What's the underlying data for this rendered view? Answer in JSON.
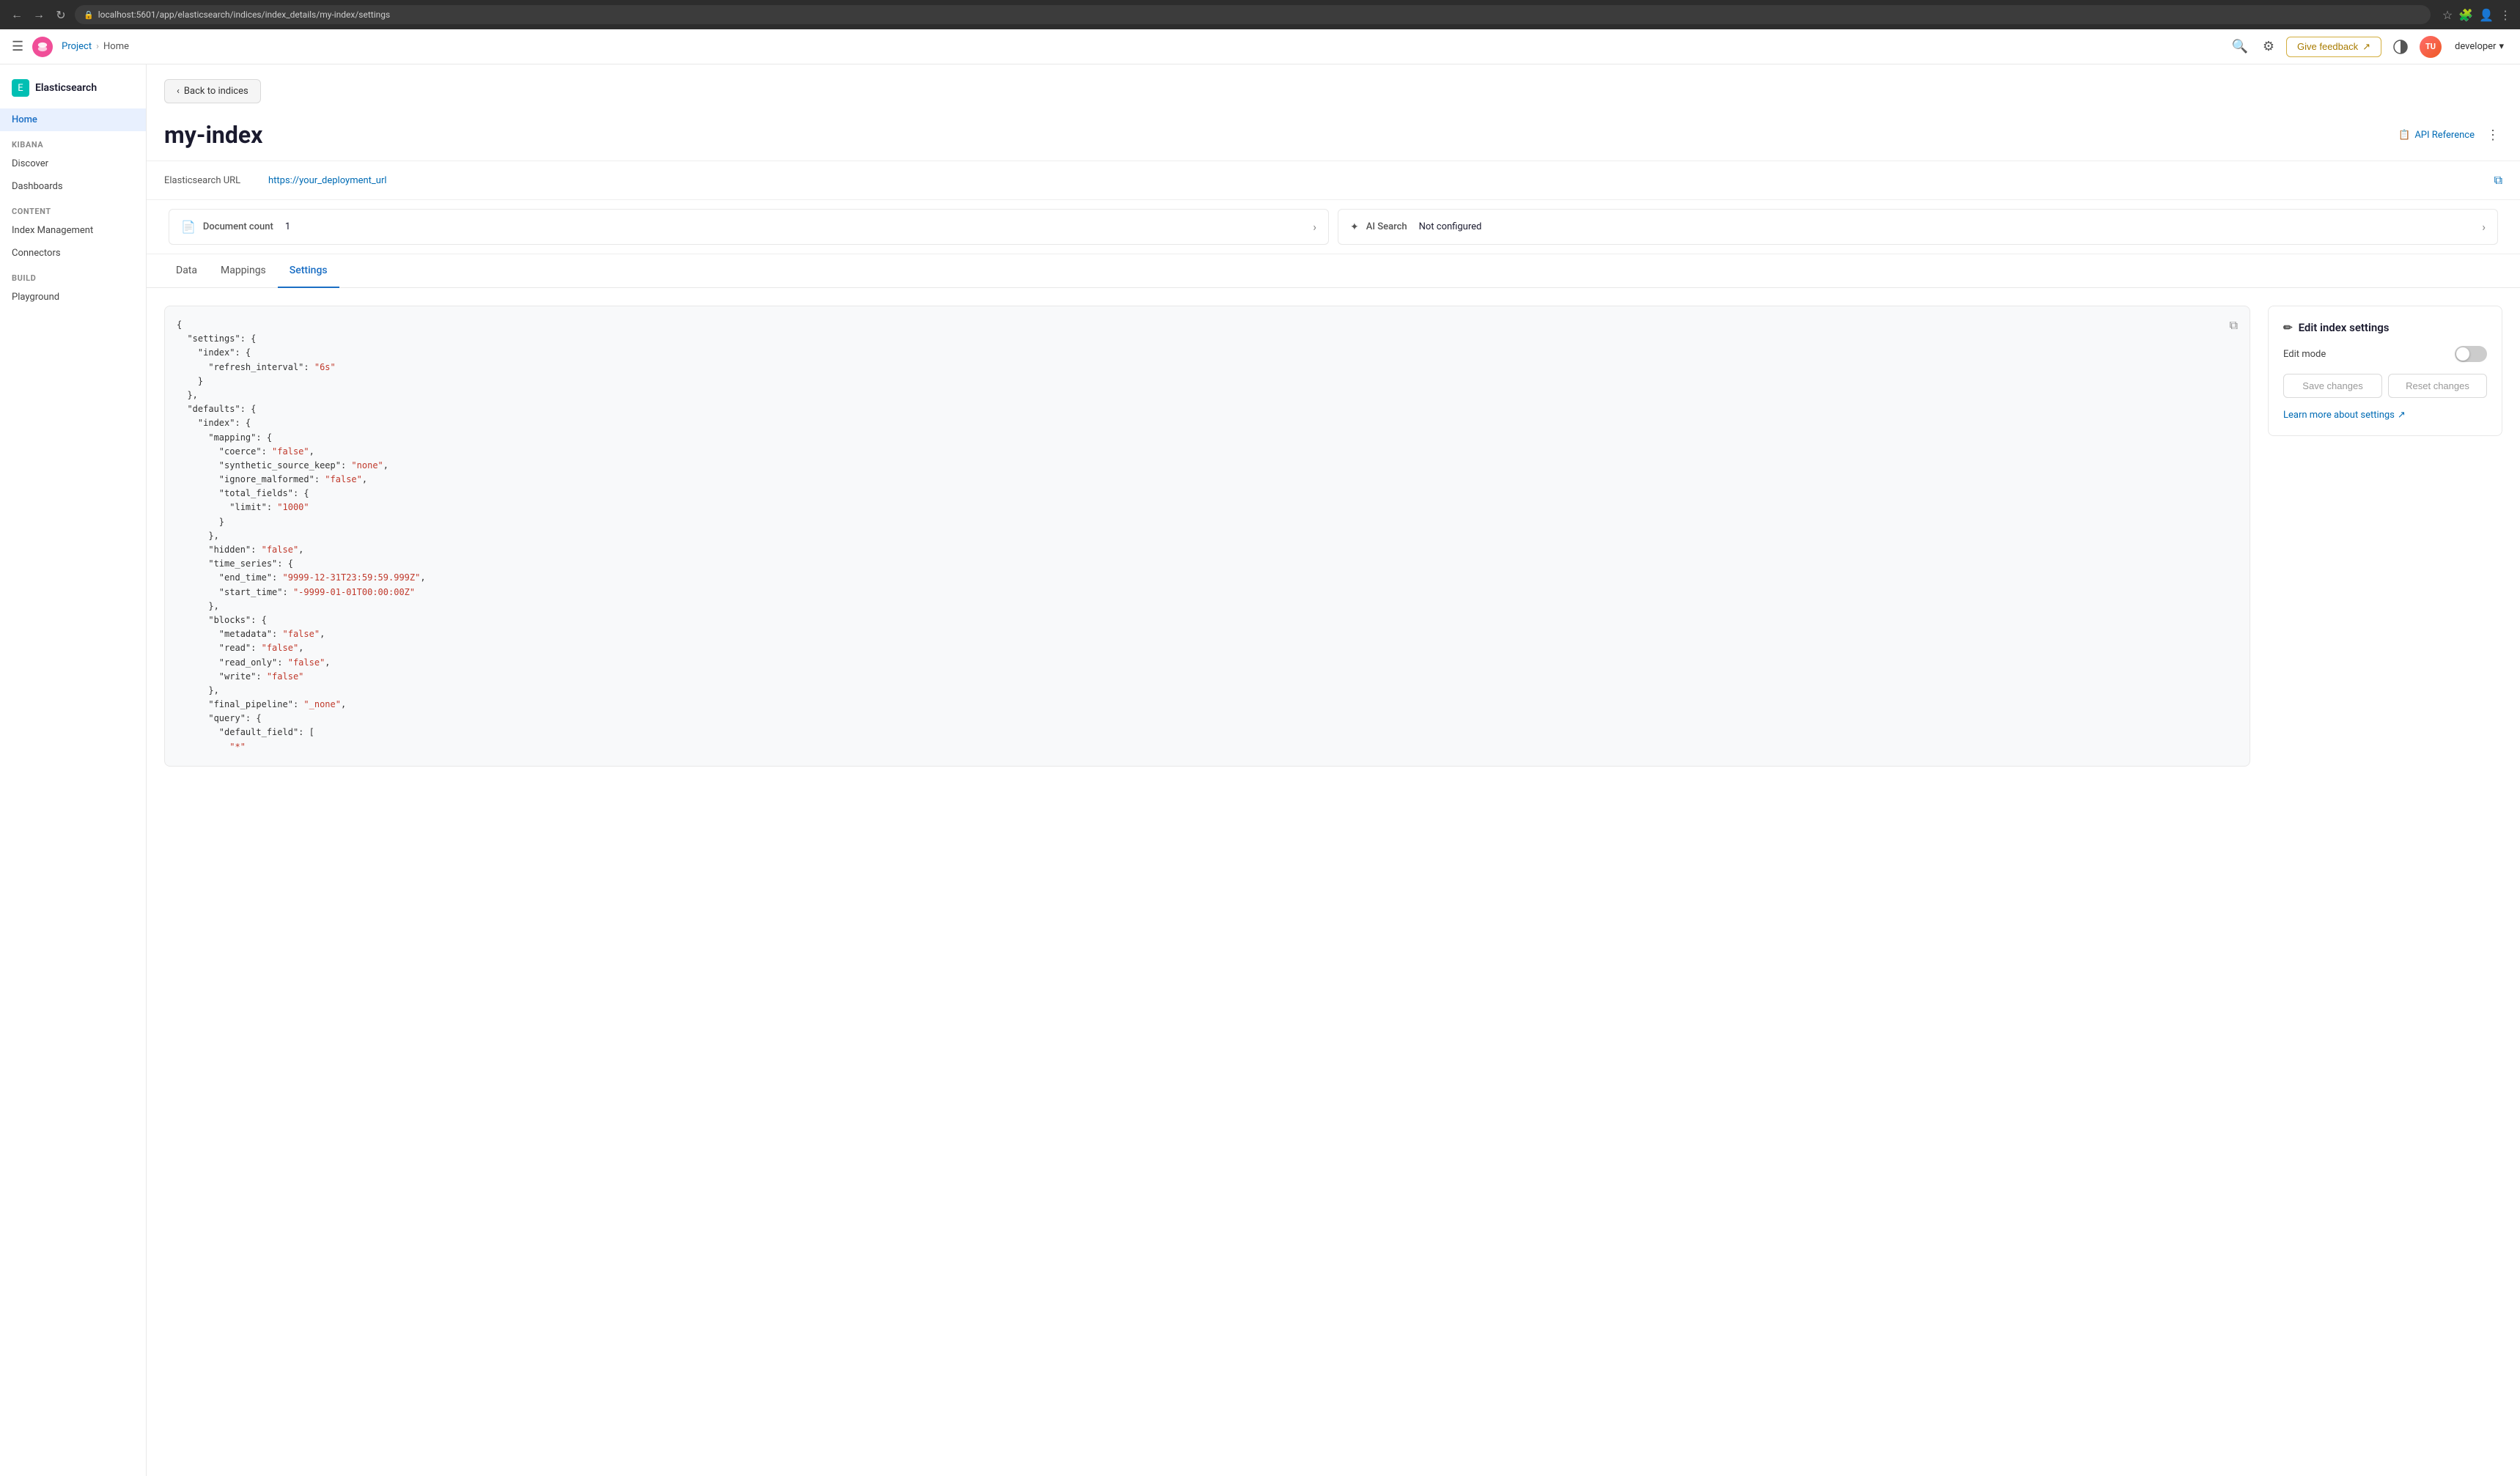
{
  "browser": {
    "url": "localhost:5601/app/elasticsearch/indices/index_details/my-index/settings",
    "back_tooltip": "Back",
    "forward_tooltip": "Forward",
    "refresh_tooltip": "Refresh"
  },
  "header": {
    "logo_alt": "Elastic",
    "project_label": "Project",
    "home_label": "Home",
    "give_feedback_label": "Give feedback",
    "user_initials": "TU",
    "developer_label": "developer",
    "chevron_down": "▾"
  },
  "sidebar": {
    "app_title": "Elasticsearch",
    "nav_items": [
      {
        "id": "home",
        "label": "Home",
        "active": true
      },
      {
        "id": "kibana-heading",
        "label": "Kibana",
        "type": "heading"
      },
      {
        "id": "discover",
        "label": "Discover",
        "active": false
      },
      {
        "id": "dashboards",
        "label": "Dashboards",
        "active": false
      },
      {
        "id": "content-heading",
        "label": "Content",
        "type": "heading"
      },
      {
        "id": "index-management",
        "label": "Index Management",
        "active": false
      },
      {
        "id": "connectors",
        "label": "Connectors",
        "active": false
      },
      {
        "id": "build-heading",
        "label": "Build",
        "type": "heading"
      },
      {
        "id": "playground",
        "label": "Playground",
        "active": false
      }
    ]
  },
  "page": {
    "back_label": "Back to indices",
    "title": "my-index",
    "api_reference_label": "API Reference",
    "more_actions_label": "More actions"
  },
  "es_url": {
    "label": "Elasticsearch URL",
    "value": "https://your_deployment_url"
  },
  "info_cards": [
    {
      "id": "document-count",
      "icon": "📄",
      "label": "Document count",
      "value": "1"
    },
    {
      "id": "ai-search",
      "icon": "✦",
      "label": "AI Search",
      "value": "Not configured"
    }
  ],
  "tabs": [
    {
      "id": "data",
      "label": "Data",
      "active": false
    },
    {
      "id": "mappings",
      "label": "Mappings",
      "active": false
    },
    {
      "id": "settings",
      "label": "Settings",
      "active": true
    }
  ],
  "json_editor": {
    "copy_tooltip": "Copy",
    "content_lines": [
      {
        "text": "{",
        "color": "default"
      },
      {
        "text": "  \"settings\": {",
        "color": "default"
      },
      {
        "text": "    \"index\": {",
        "color": "default"
      },
      {
        "text": "      \"refresh_interval\": \"6s\"",
        "color": "string"
      },
      {
        "text": "    }",
        "color": "default"
      },
      {
        "text": "  },",
        "color": "default"
      },
      {
        "text": "  \"defaults\": {",
        "color": "default"
      },
      {
        "text": "    \"index\": {",
        "color": "default"
      },
      {
        "text": "      \"mapping\": {",
        "color": "default"
      },
      {
        "text": "        \"coerce\": \"false\",",
        "color": "string"
      },
      {
        "text": "        \"synthetic_source_keep\": \"none\",",
        "color": "string"
      },
      {
        "text": "        \"ignore_malformed\": \"false\",",
        "color": "string"
      },
      {
        "text": "        \"total_fields\": {",
        "color": "default"
      },
      {
        "text": "          \"limit\": \"1000\"",
        "color": "string"
      },
      {
        "text": "        }",
        "color": "default"
      },
      {
        "text": "      },",
        "color": "default"
      },
      {
        "text": "      \"hidden\": \"false\",",
        "color": "string"
      },
      {
        "text": "      \"time_series\": {",
        "color": "default"
      },
      {
        "text": "        \"end_time\": \"9999-12-31T23:59:59.999Z\",",
        "color": "string"
      },
      {
        "text": "        \"start_time\": \"-9999-01-01T00:00:00Z\"",
        "color": "string"
      },
      {
        "text": "      },",
        "color": "default"
      },
      {
        "text": "      \"blocks\": {",
        "color": "default"
      },
      {
        "text": "        \"metadata\": \"false\",",
        "color": "string"
      },
      {
        "text": "        \"read\": \"false\",",
        "color": "string"
      },
      {
        "text": "        \"read_only\": \"false\",",
        "color": "string"
      },
      {
        "text": "        \"write\": \"false\"",
        "color": "string"
      },
      {
        "text": "      },",
        "color": "default"
      },
      {
        "text": "      \"final_pipeline\": \"_none\",",
        "color": "string"
      },
      {
        "text": "      \"query\": {",
        "color": "default"
      },
      {
        "text": "        \"default_field\": [",
        "color": "default"
      },
      {
        "text": "          \"*\"",
        "color": "string"
      }
    ]
  },
  "edit_panel": {
    "title": "Edit index settings",
    "pencil_icon": "✏",
    "edit_mode_label": "Edit mode",
    "toggle_state": "off",
    "save_changes_label": "Save changes",
    "reset_changes_label": "Reset changes",
    "learn_more_label": "Learn more about settings",
    "external_icon": "↗"
  }
}
